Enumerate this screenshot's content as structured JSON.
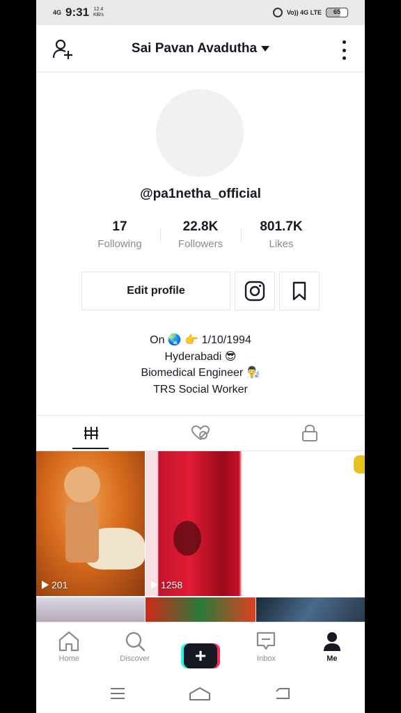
{
  "status_bar": {
    "network": "4G",
    "time": "9:31",
    "speed_value": "12.4",
    "speed_unit": "KB/s",
    "volte": "Vo)) 4G LTE",
    "battery": "65"
  },
  "header": {
    "title": "Sai Pavan Avadutha",
    "add_user_icon": "add-user-icon",
    "more_icon": "more-vertical-icon"
  },
  "profile": {
    "username": "@pa1netha_official",
    "stats": [
      {
        "value": "17",
        "label": "Following"
      },
      {
        "value": "22.8K",
        "label": "Followers"
      },
      {
        "value": "801.7K",
        "label": "Likes"
      }
    ],
    "edit_label": "Edit profile",
    "bio_lines": [
      "On 🌏 👉 1/10/1994",
      "Hyderabadi 😎",
      "Biomedical Engineer 👨‍🔬",
      "TRS Social Worker"
    ]
  },
  "tabs": [
    {
      "name": "videos",
      "icon": "grid-icon",
      "active": true
    },
    {
      "name": "liked",
      "icon": "liked-hidden-icon",
      "active": false
    },
    {
      "name": "private",
      "icon": "lock-icon",
      "active": false
    }
  ],
  "videos": [
    {
      "views": "201"
    },
    {
      "views": "1258"
    },
    {
      "views": ""
    }
  ],
  "bottom_nav": {
    "home": "Home",
    "discover": "Discover",
    "inbox": "Inbox",
    "me": "Me"
  },
  "colors": {
    "accent_pink": "#fe2c55",
    "accent_cyan": "#25f4ee",
    "text": "#161823",
    "secondary_text": "#8a8b91"
  }
}
